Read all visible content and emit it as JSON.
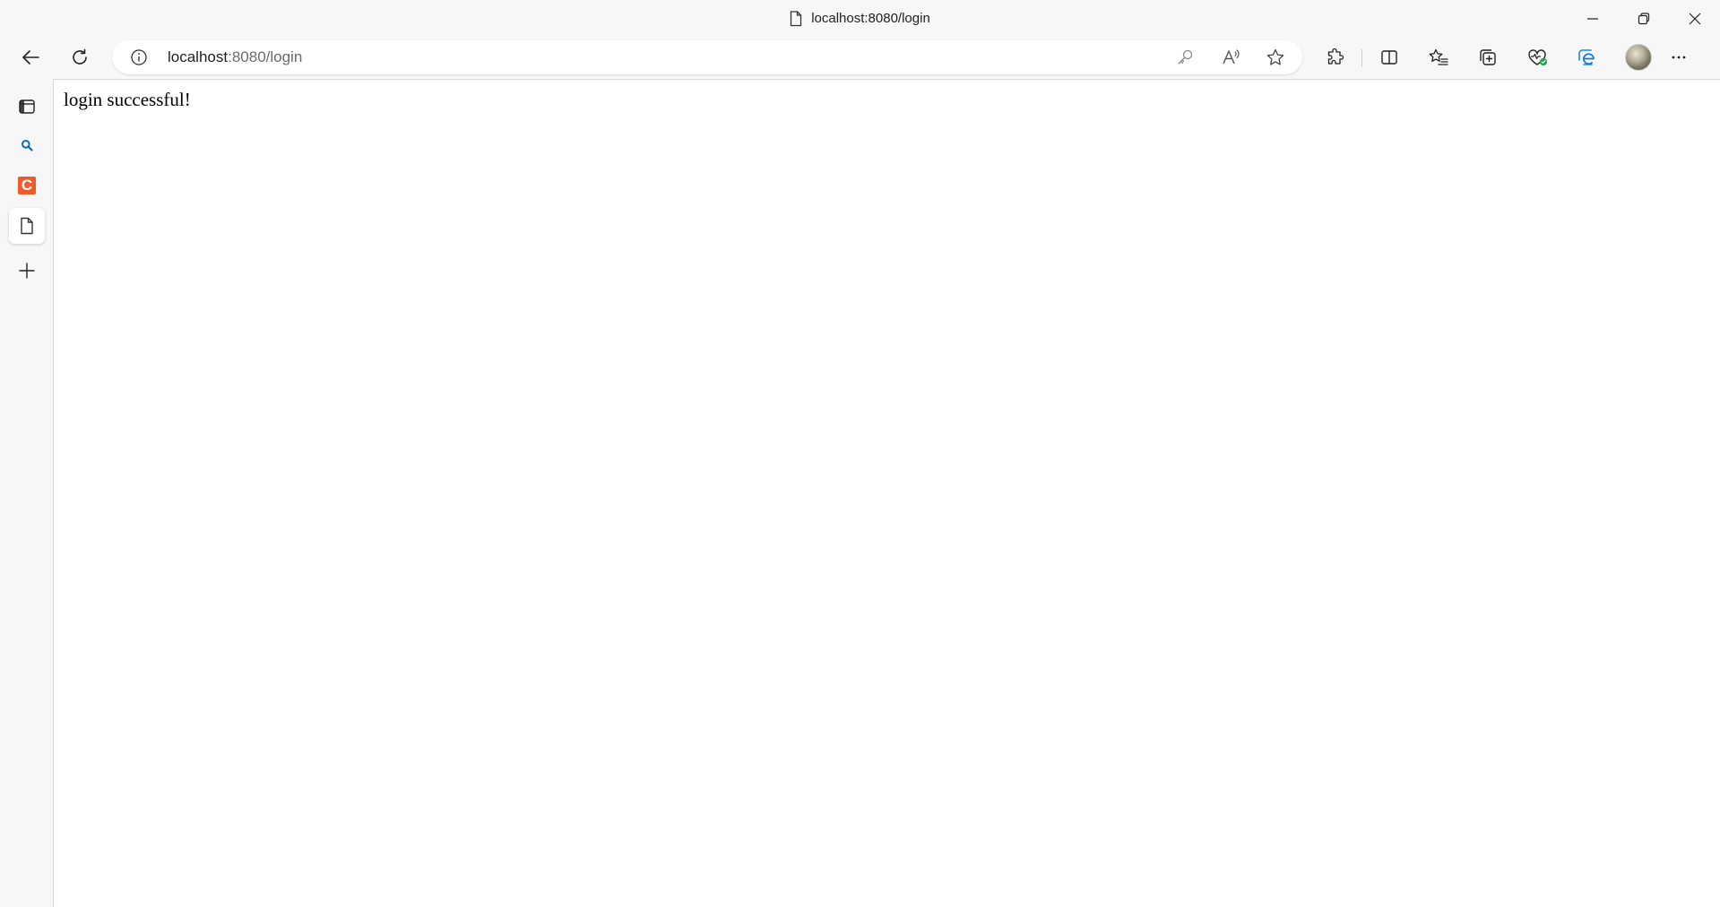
{
  "window": {
    "title": "localhost:8080/login",
    "icons": {
      "page": "page-icon",
      "minimize": "minimize-icon",
      "restore": "restore-icon",
      "close": "close-icon"
    }
  },
  "toolbar": {
    "back_icon": "back-arrow-icon",
    "refresh_icon": "refresh-icon",
    "address": {
      "host": "localhost",
      "path": ":8080/login",
      "info_icon": "info-icon"
    },
    "address_icons": [
      "key-icon",
      "read-aloud-icon",
      "favorite-star-icon"
    ],
    "right_icons": [
      "extensions-icon",
      "split-screen-icon",
      "favorites-icon",
      "collections-icon",
      "browser-essentials-icon",
      "edge-icon",
      "profile-avatar",
      "more-icon"
    ]
  },
  "sidebar": {
    "items": [
      "tabs-icon",
      "search-icon",
      "c-app-icon",
      "page-tab-icon",
      "add-icon"
    ],
    "c_label": "C"
  },
  "page": {
    "message": "login successful!"
  },
  "colors": {
    "chrome_bg": "#f7f7f7",
    "content_bg": "#ffffff",
    "c_brand": "#f05b2c",
    "search_blue": "#0f6cbd"
  }
}
